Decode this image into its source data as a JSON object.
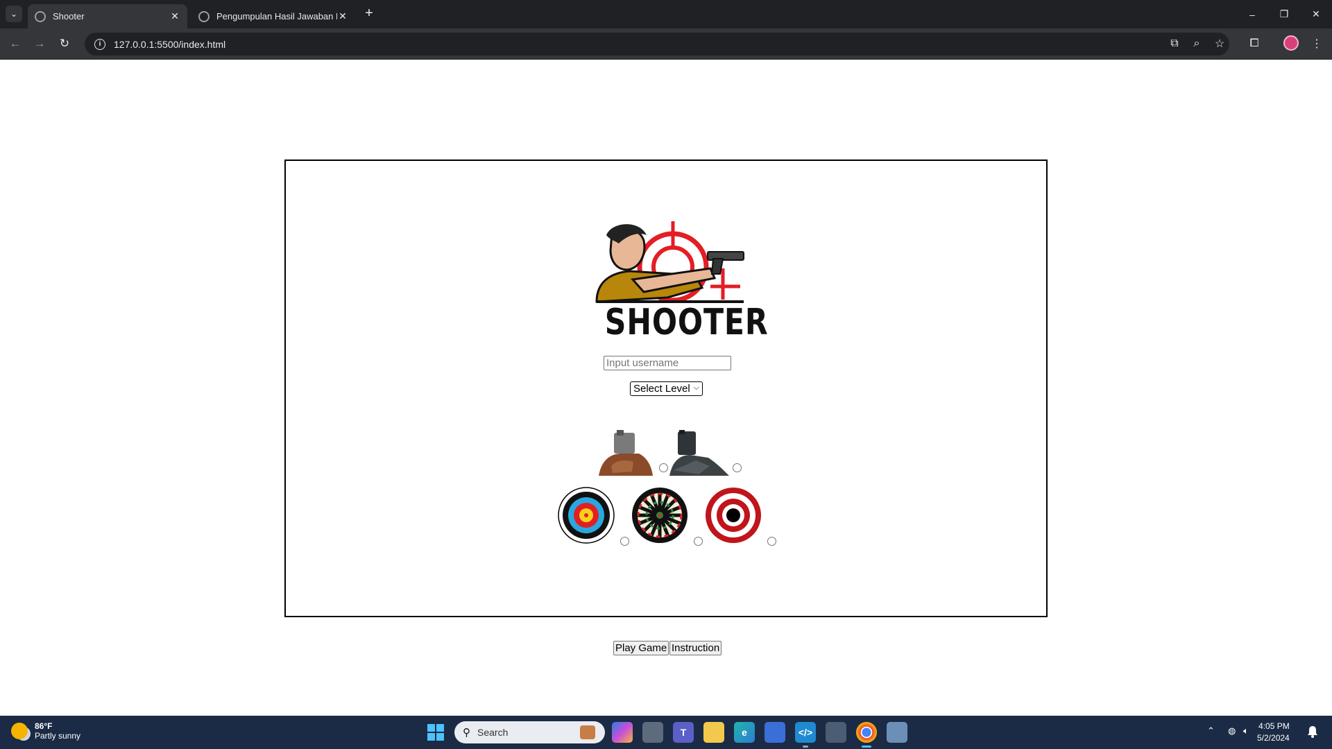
{
  "browser": {
    "tabs": [
      {
        "label": "Shooter",
        "active": true
      },
      {
        "label": "Pengumpulan Hasil Jawaban LK",
        "active": false
      }
    ],
    "address": "127.0.0.1:5500/index.html",
    "window_controls": {
      "minimize": "–",
      "restore": "❐",
      "close": "✕"
    }
  },
  "page": {
    "logo_text": "SHOOTER",
    "username_placeholder": "Input username",
    "username_value": "",
    "level_select": {
      "selected": "Select Level"
    },
    "gun_options": [
      {
        "icon": "pistol-hand-icon",
        "selected": false
      },
      {
        "icon": "dark-pistol-hand-icon",
        "selected": false
      }
    ],
    "target_options": [
      {
        "icon": "archery-target-icon",
        "selected": false
      },
      {
        "icon": "dartboard-target-icon",
        "selected": false
      },
      {
        "icon": "red-bullseye-target-icon",
        "selected": false
      }
    ],
    "buttons": {
      "play": "Play Game",
      "instruction": "Instruction"
    }
  },
  "taskbar": {
    "weather": {
      "temp": "86°F",
      "condition": "Partly sunny"
    },
    "search_placeholder": "Search",
    "clock": {
      "time": "4:05 PM",
      "date": "5/2/2024"
    }
  },
  "colors": {
    "tab_strip": "#202124",
    "toolbar": "#35363a",
    "taskbar": "#1b2b45",
    "logo_red": "#e31e24",
    "logo_shirt": "#b8860b"
  }
}
